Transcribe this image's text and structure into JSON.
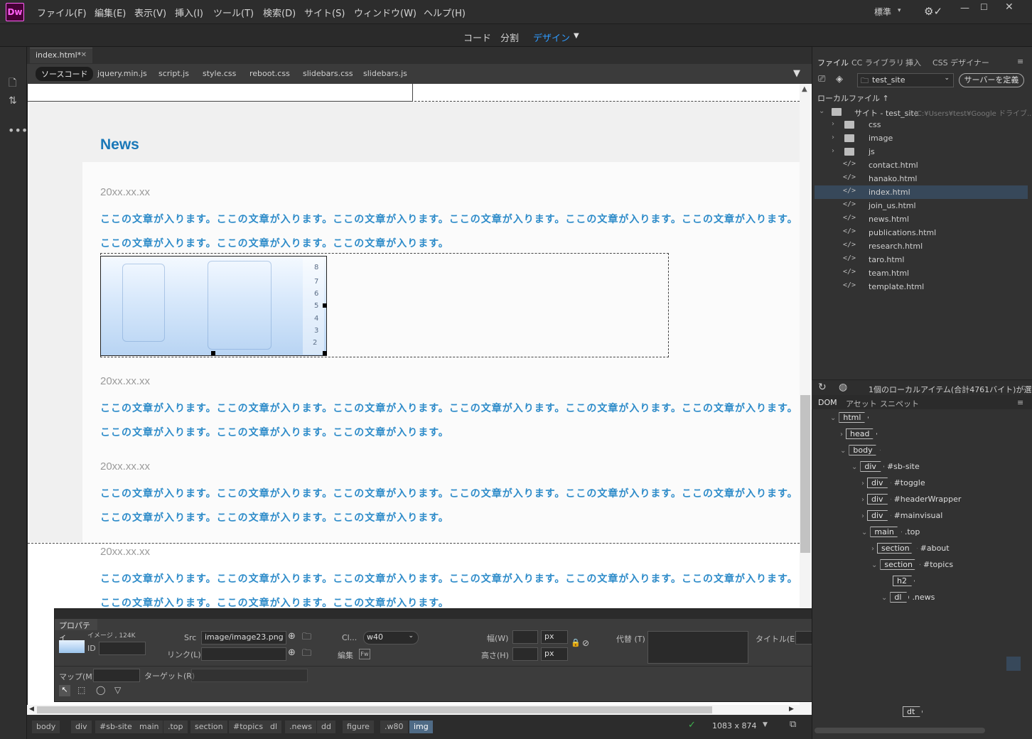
{
  "app": {
    "logo": "Dw"
  },
  "menu": [
    "ファイル(F)",
    "編集(E)",
    "表示(V)",
    "挿入(I)",
    "ツール(T)",
    "検索(D)",
    "サイト(S)",
    "ウィンドウ(W)",
    "ヘルプ(H)"
  ],
  "workspace": "標準",
  "views": {
    "code": "コード",
    "split": "分割",
    "design": "デザイン"
  },
  "doc_tab": "index.html*",
  "related_files": [
    "ソースコード",
    "jquery.min.js",
    "script.js",
    "style.css",
    "reboot.css",
    "slidebars.css",
    "slidebars.js"
  ],
  "page": {
    "news_title": "News",
    "items": [
      {
        "date": "20xx.xx.xx",
        "line1": "ここの文章が入ります。ここの文章が入ります。ここの文章が入ります。ここの文章が入ります。ここの文章が入ります。ここの文章が入ります。",
        "line2": "ここの文章が入ります。ここの文章が入ります。ここの文章が入ります。"
      },
      {
        "date": "20xx.xx.xx",
        "line1": "ここの文章が入ります。ここの文章が入ります。ここの文章が入ります。ここの文章が入ります。ここの文章が入ります。ここの文章が入ります。",
        "line2": "ここの文章が入ります。ここの文章が入ります。ここの文章が入ります。"
      },
      {
        "date": "20xx.xx.xx",
        "line1": "ここの文章が入ります。ここの文章が入ります。ここの文章が入ります。ここの文章が入ります。ここの文章が入ります。ここの文章が入ります。",
        "line2": "ここの文章が入ります。ここの文章が入ります。ここの文章が入ります。"
      },
      {
        "date": "20xx.xx.xx",
        "line1": "ここの文章が入ります。ここの文章が入ります。ここの文章が入ります。ここの文章が入ります。ここの文章が入ります。ここの文章が入ります。",
        "line2": "ここの文章が入ります。ここの文章が入ります。ここの文章が入ります。"
      }
    ],
    "image_numbers": [
      "8",
      "7",
      "6",
      "5",
      "4",
      "3",
      "2"
    ]
  },
  "tag_selector": [
    "body",
    "div",
    "#sb-site",
    "main",
    ".top",
    "section",
    "#topics",
    "dl",
    ".news",
    "dd",
    "figure",
    ".w80",
    "img"
  ],
  "window_size": "1083 x 874",
  "properties": {
    "title": "プロパティ",
    "kind": "イメージ , 124K",
    "id_label": "ID",
    "src_label": "Src",
    "src_value": "image/image23.png",
    "link_label": "リンク(L)",
    "class_label": "Cl...",
    "class_value": "w40",
    "edit_label": "編集",
    "edit_badge": "Fw",
    "width_label": "幅(W)",
    "height_label": "高さ(H)",
    "unit": "px",
    "alt_label": "代替 (T)",
    "title_label": "タイトル(E)",
    "map_label": "マップ(M)",
    "target_label": "ターゲット(R)"
  },
  "files_panel": {
    "tabs": [
      "ファイル",
      "CC ライブラリ",
      "挿入",
      "CSS デザイナー"
    ],
    "site": "test_site",
    "define_server": "サーバーを定義",
    "local_files": "ローカルファイル ↑",
    "site_root": "サイト - test_site",
    "site_path": "(C:¥Users¥test¥Google ドライブ...",
    "folders": [
      "css",
      "image",
      "js"
    ],
    "files": [
      "contact.html",
      "hanako.html",
      "index.html",
      "join_us.html",
      "news.html",
      "publications.html",
      "research.html",
      "taro.html",
      "team.html",
      "template.html"
    ],
    "selected_file": "index.html",
    "status": "1個のローカルアイテム(合計4761バイト)が選..."
  },
  "dom_panel": {
    "tabs": [
      "DOM",
      "アセット",
      "スニペット"
    ],
    "nodes": [
      {
        "tag": "html",
        "sel": ""
      },
      {
        "tag": "head",
        "sel": ""
      },
      {
        "tag": "body",
        "sel": ""
      },
      {
        "tag": "div",
        "sel": "#sb-site"
      },
      {
        "tag": "div",
        "sel": "#toggle"
      },
      {
        "tag": "div",
        "sel": "#headerWrapper"
      },
      {
        "tag": "div",
        "sel": "#mainvisual"
      },
      {
        "tag": "main",
        "sel": ".top"
      },
      {
        "tag": "section",
        "sel": "#about"
      },
      {
        "tag": "section",
        "sel": "#topics"
      },
      {
        "tag": "h2",
        "sel": ""
      },
      {
        "tag": "dl",
        "sel": ".news"
      }
    ],
    "bottom_node": "dt"
  },
  "colors": {
    "accent": "#2f9bff",
    "heading": "#1a78b8",
    "body_text": "#2d8bc9",
    "selection": "#37485a"
  }
}
